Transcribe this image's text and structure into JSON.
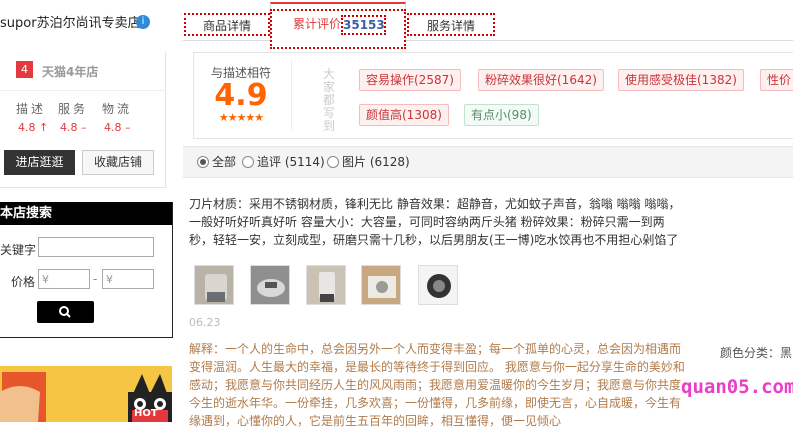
{
  "shop": {
    "name": "supor苏泊尔尚讯专卖店",
    "badge_icon": "info-icon",
    "tmall_years_num": "4",
    "tmall_years_label": "天猫4年店",
    "ratings": [
      {
        "label": "描述",
        "value": "4.8 ↑"
      },
      {
        "label": "服务",
        "value": "4.8 –"
      },
      {
        "label": "物流",
        "value": "4.8 –"
      }
    ],
    "enter_label": "进店逛逛",
    "fav_label": "收藏店铺"
  },
  "search": {
    "title": "本店搜索",
    "keyword_label": "关键字",
    "price_label": "价格",
    "price_min_placeholder": "¥",
    "price_max_placeholder": "¥",
    "dash": "-"
  },
  "banner": {
    "badge": "HOT"
  },
  "tabs": [
    {
      "label": "商品详情"
    },
    {
      "label": "累计评价",
      "count": "35153"
    },
    {
      "label": "服务详情"
    }
  ],
  "summary": {
    "match_label": "与描述相符",
    "score": "4.9",
    "stars": "★★★★★",
    "vertical_label": "大家都写到",
    "tags": [
      {
        "label": "容易操作(2587)",
        "sentiment": "pos"
      },
      {
        "label": "粉碎效果很好(1642)",
        "sentiment": "pos"
      },
      {
        "label": "使用感受极佳(1382)",
        "sentiment": "pos"
      },
      {
        "label": "性价",
        "sentiment": "pos"
      },
      {
        "label": "颜值高(1308)",
        "sentiment": "pos"
      },
      {
        "label": "有点小(98)",
        "sentiment": "neg"
      }
    ]
  },
  "filters": [
    {
      "label": "全部",
      "selected": true
    },
    {
      "label": "追评 (5114)",
      "selected": false
    },
    {
      "label": "图片 (6128)",
      "selected": false
    }
  ],
  "review": {
    "text": "刀片材质：采用不锈钢材质，锋利无比 静音效果：超静音，尤如蚊子声音，翁嗡 嗡嗡 嗡嗡，一般好听好听真好听 容量大小：大容量，可同时容纳两斤头猪 粉碎效果：粉碎只需一到两秒，轻轻一安，立刻成型，研磨只需十几秒，以后男朋友(王一博)吃水饺再也不用担心剁馅了",
    "date": "06.23",
    "reply": "解释：一个人的生命中，总会因另外一个人而变得丰盈；每一个孤单的心灵，总会因为相遇而变得温润。人生最大的幸福，是最长的等待终于得到回应。 我愿意与你一起分享生命的美妙和感动；我愿意与你共同经历人生的风风雨雨；我愿意用爱温暖你的今生岁月；我愿意与你共度今生的逝水年华。一份牵挂，几多欢喜；一份懂得，几多前缘，即使无言，心自成暖，今生有缘遇到，心懂你的人，它是前生五百年的回眸，相互懂得，便一见倾心",
    "color_category": "颜色分类：黑"
  },
  "watermark": "quan05.com",
  "colors": {
    "accent": "#e4393c",
    "score": "#ff6400"
  }
}
